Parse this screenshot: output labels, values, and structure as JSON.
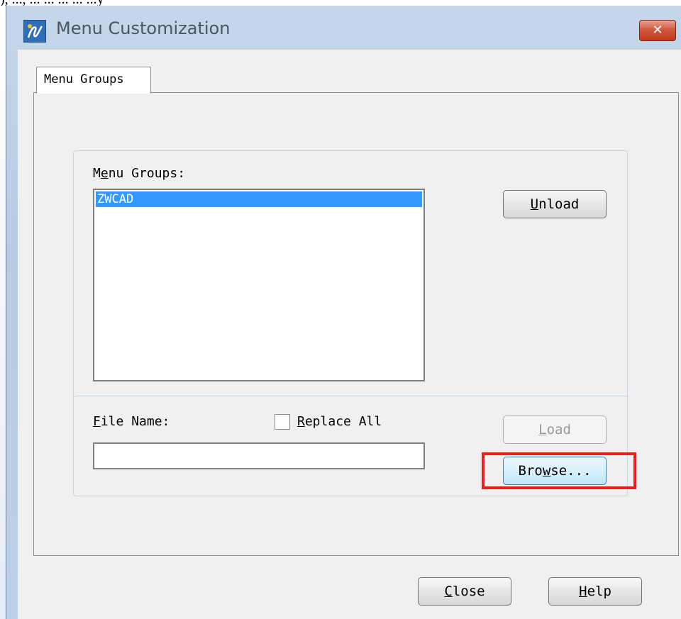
{
  "page_fragment": "), ..., ... ... ... ... ...y",
  "window": {
    "title": "Menu Customization",
    "close_glyph": "✕",
    "app_icon": "zwcad-app-icon"
  },
  "tab": {
    "label": "Menu Groups"
  },
  "menu_groups": {
    "label_prefix": "M",
    "label_mnemonic": "e",
    "label_rest": "nu Groups:",
    "items": [
      "ZWCAD"
    ],
    "selected_index": 0
  },
  "buttons": {
    "unload": {
      "mnemonic": "U",
      "rest": "nload"
    },
    "load": {
      "mnemonic": "L",
      "rest": "oad",
      "disabled": true
    },
    "browse": {
      "prefix": "Bro",
      "mnemonic": "w",
      "rest": "se..."
    },
    "close": {
      "mnemonic": "C",
      "rest": "lose"
    },
    "help": {
      "mnemonic": "H",
      "rest": "elp"
    }
  },
  "file_name": {
    "label_mnemonic": "F",
    "label_rest": "ile Name:",
    "value": ""
  },
  "replace_all": {
    "mnemonic": "R",
    "rest": "eplace All",
    "checked": false
  },
  "annotation": {
    "color": "#e8211f"
  }
}
